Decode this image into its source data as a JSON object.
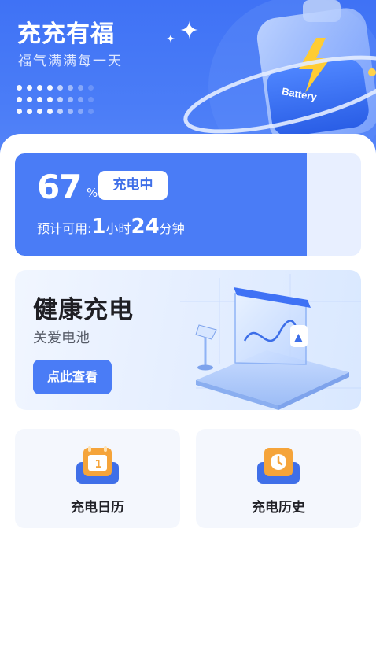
{
  "header": {
    "title": "充充有福",
    "subtitle": "福气满满每一天",
    "battery_text": "Battery",
    "bg_color": "#4a7cf6"
  },
  "charge": {
    "percent": "67",
    "percent_unit": "%",
    "level": 0.67,
    "status": "充电中",
    "remain_label": "预计可用:",
    "hours": "1",
    "hours_unit": "小时",
    "minutes": "24",
    "minutes_unit": "分钟"
  },
  "health": {
    "title": "健康充电",
    "subtitle": "关爱电池",
    "button": "点此查看"
  },
  "tiles": [
    {
      "label": "充电日历",
      "icon": "calendar-icon",
      "icon_text": "1"
    },
    {
      "label": "充电历史",
      "icon": "clock-icon"
    }
  ],
  "colors": {
    "accent": "#4a7cf6",
    "icon_orange": "#f5a43a",
    "icon_blue": "#3f6fe8"
  }
}
